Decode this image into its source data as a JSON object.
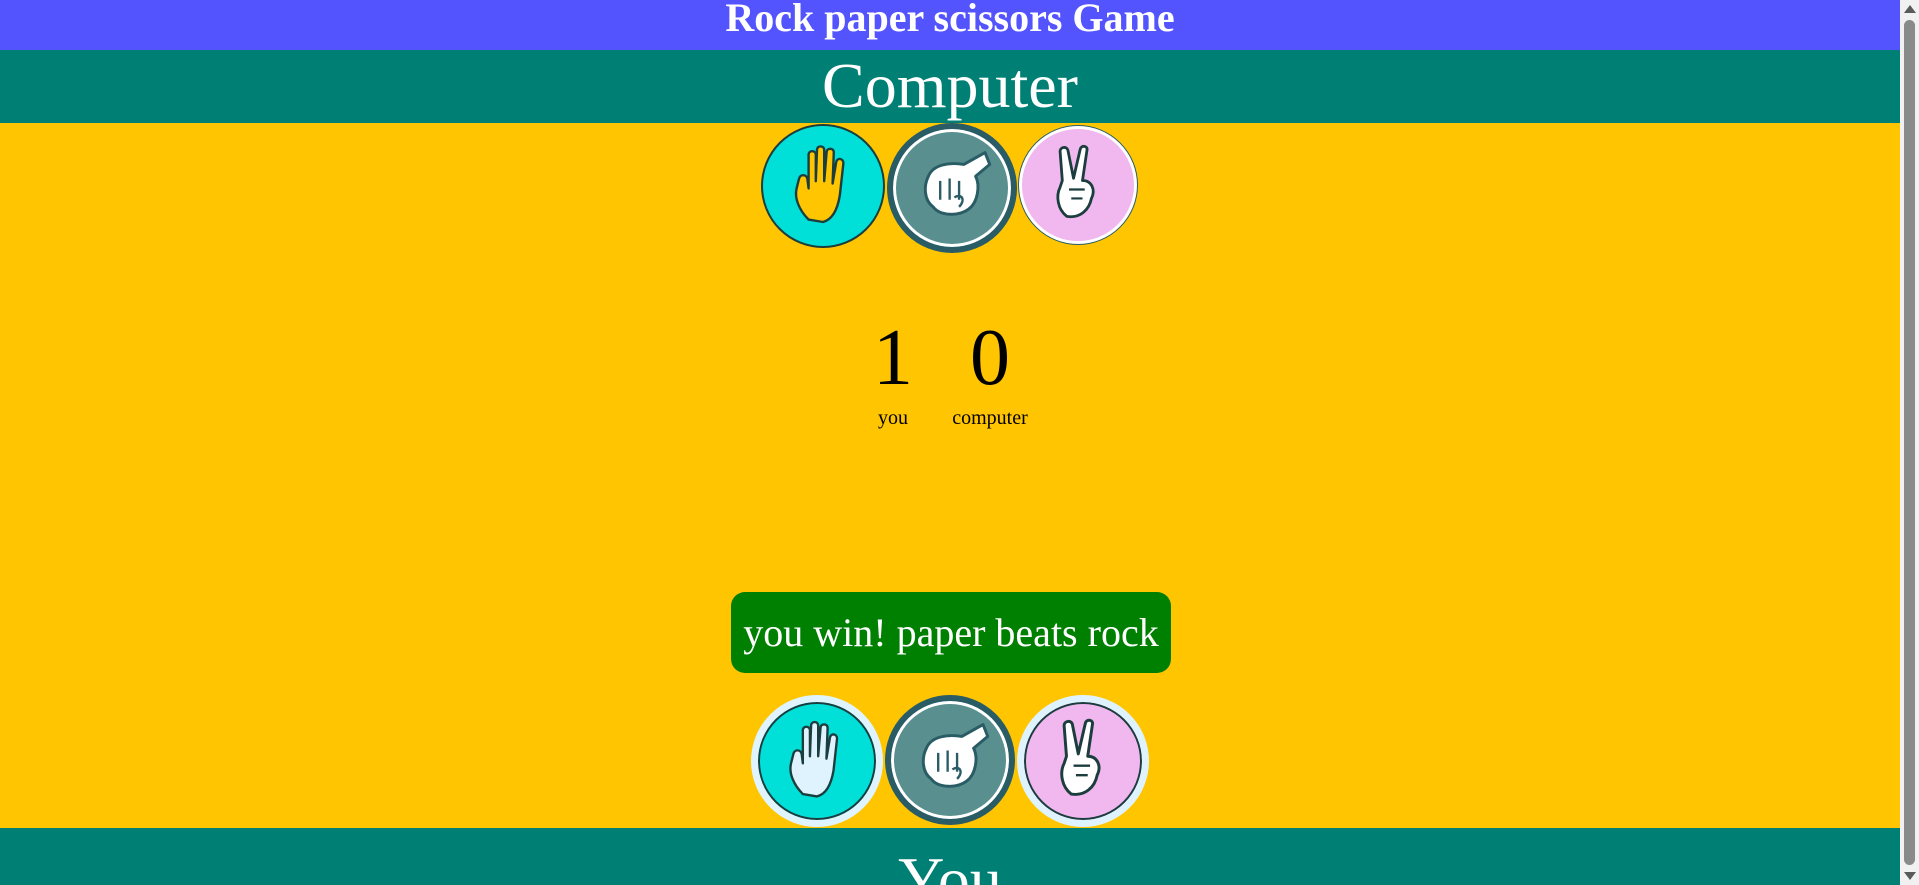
{
  "app": {
    "title": "Rock paper scissors Game"
  },
  "computer_section": {
    "label": "Computer"
  },
  "player_section": {
    "label": "You"
  },
  "scores": {
    "player_score": "1",
    "player_label": "you",
    "computer_score": "0",
    "computer_label": "computer"
  },
  "result": {
    "message": "you win! paper beats rock"
  },
  "choices": {
    "paper": {
      "icon": "paper-hand-icon",
      "color": "#00e0d8"
    },
    "rock": {
      "icon": "rock-fist-icon",
      "color": "#5a8f8f"
    },
    "scissors": {
      "icon": "scissors-hand-icon",
      "color": "#f0b8ee"
    }
  },
  "colors": {
    "title_bar": "#5454ff",
    "band": "#008075",
    "game_bg": "#ffc500",
    "result_bg": "#008000"
  }
}
